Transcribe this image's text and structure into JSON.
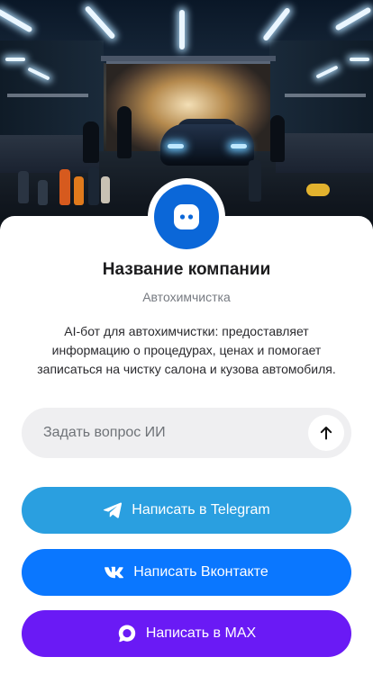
{
  "company": {
    "name": "Название компании",
    "category": "Автохимчистка",
    "description": "AI-бот для автохимчистки: предоставляет информацию о процедурах, ценах и помогает записаться на чистку салона и кузова автомобиля."
  },
  "ask": {
    "placeholder": "Задать вопрос ИИ",
    "value": ""
  },
  "buttons": {
    "telegram": {
      "label": "Написать в Telegram",
      "color": "#2a9fe0",
      "icon": "telegram-icon"
    },
    "vk": {
      "label": "Написать Вконтакте",
      "color": "#0a77ff",
      "icon": "vk-icon"
    },
    "max": {
      "label": "Написать в MAX",
      "color": "#6a1af5",
      "icon": "max-icon"
    }
  },
  "colors": {
    "avatar": "#0b67d8",
    "input_bg": "#efeff1"
  }
}
